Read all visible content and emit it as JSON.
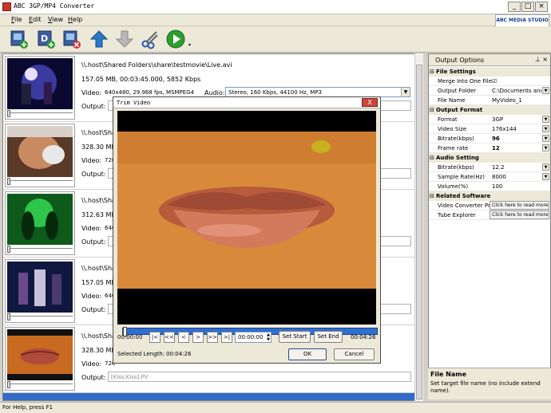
{
  "window": {
    "title": "ABC 3GP/MP4 Converter"
  },
  "menu": [
    {
      "first": "F",
      "rest": "ile"
    },
    {
      "first": "E",
      "rest": "dit"
    },
    {
      "first": "V",
      "rest": "iew"
    },
    {
      "first": "H",
      "rest": "elp"
    }
  ],
  "logo": "ABC MEDIA STUDIO",
  "files": [
    {
      "path": "\\\\.host\\Shared Folders\\share\\testmovie\\Live.avi",
      "info": "157.05 MB, 00:03:45.000, 5852 Kbps",
      "video_label": "Video:",
      "video": "640x480, 29.968 fps, MSMPEG4",
      "audio_label": "Audio:",
      "audio": "Stereo, 160 Kbps, 44100 Hz, MP3",
      "output_label": "Output:",
      "output": ""
    },
    {
      "path": "\\\\.host\\Shared Folders\\sh",
      "info": "328.30 MB, 00",
      "video_label": "Video:",
      "video": "720",
      "audio_label": "",
      "audio": "",
      "output_label": "Output:",
      "output": ""
    },
    {
      "path": "\\\\.host\\Shared Folders\\sh",
      "info": "312.63 MB, 00",
      "video_label": "Video:",
      "video": "640",
      "audio_label": "",
      "audio": "",
      "output_label": "Output:",
      "output": ""
    },
    {
      "path": "\\\\.host\\Shared Folders\\sh",
      "info": "157.05 MB, 00",
      "video_label": "Video:",
      "video": "640",
      "audio_label": "",
      "audio": "",
      "output_label": "Output:",
      "output": ""
    },
    {
      "path": "\\\\.host\\Shared Folders\\sh",
      "info": "328.30 MB, 00",
      "video_label": "Video:",
      "video": "720",
      "audio_label": "",
      "audio": "",
      "output_label": "Output:",
      "output": "[Kiss.Kiss].PV"
    }
  ],
  "dialog": {
    "title": "Trim Video",
    "close": "X",
    "start_time": "00:00:00",
    "time_input": "00:00:00",
    "end_time": "00:04:26",
    "set_start": "Set Start",
    "set_end": "Set End",
    "selected_length_label": "Selected Length:",
    "selected_length": "00:04:26",
    "ok": "OK",
    "cancel": "Cancel",
    "nav": [
      "|<",
      "<<",
      "<",
      ">",
      ">>",
      ">|"
    ]
  },
  "options": {
    "title": "Output Options",
    "sections": [
      {
        "name": "File Settings",
        "rows": [
          {
            "key": "Merge Into One File",
            "value": "☑",
            "dd": false
          },
          {
            "key": "Output Folder",
            "value": "C:\\Documents and",
            "dd": true
          },
          {
            "key": "File Name",
            "value": "MyVideo_1",
            "dd": false
          }
        ]
      },
      {
        "name": "Output Format",
        "rows": [
          {
            "key": "Format",
            "value": "3GP",
            "dd": true
          },
          {
            "key": "Video Size",
            "value": "176x144",
            "dd": true
          },
          {
            "key": "Bitrate(kbps)",
            "value": "96",
            "dd": true
          },
          {
            "key": "Frame rate",
            "value": "12",
            "dd": true
          }
        ]
      },
      {
        "name": "Audio Setting",
        "rows": [
          {
            "key": "Bitrate(kbps)",
            "value": "12.2",
            "dd": true
          },
          {
            "key": "Sample Rate(Hz)",
            "value": "8000",
            "dd": true
          },
          {
            "key": "Volume(%)",
            "value": "100",
            "dd": false
          }
        ]
      },
      {
        "name": "Related Software",
        "rows": [
          {
            "key": "Video Converter Pro",
            "button": "Click here to read more"
          },
          {
            "key": "Tube Explorer",
            "button": "Click here to read more"
          }
        ]
      }
    ],
    "desc_title": "File Name",
    "desc_text": "Set target file name (no include extend name)."
  },
  "status": "For Help, press F1",
  "colors": {
    "accent": "#2f6fd0",
    "toolbar": "#ece9d8"
  }
}
